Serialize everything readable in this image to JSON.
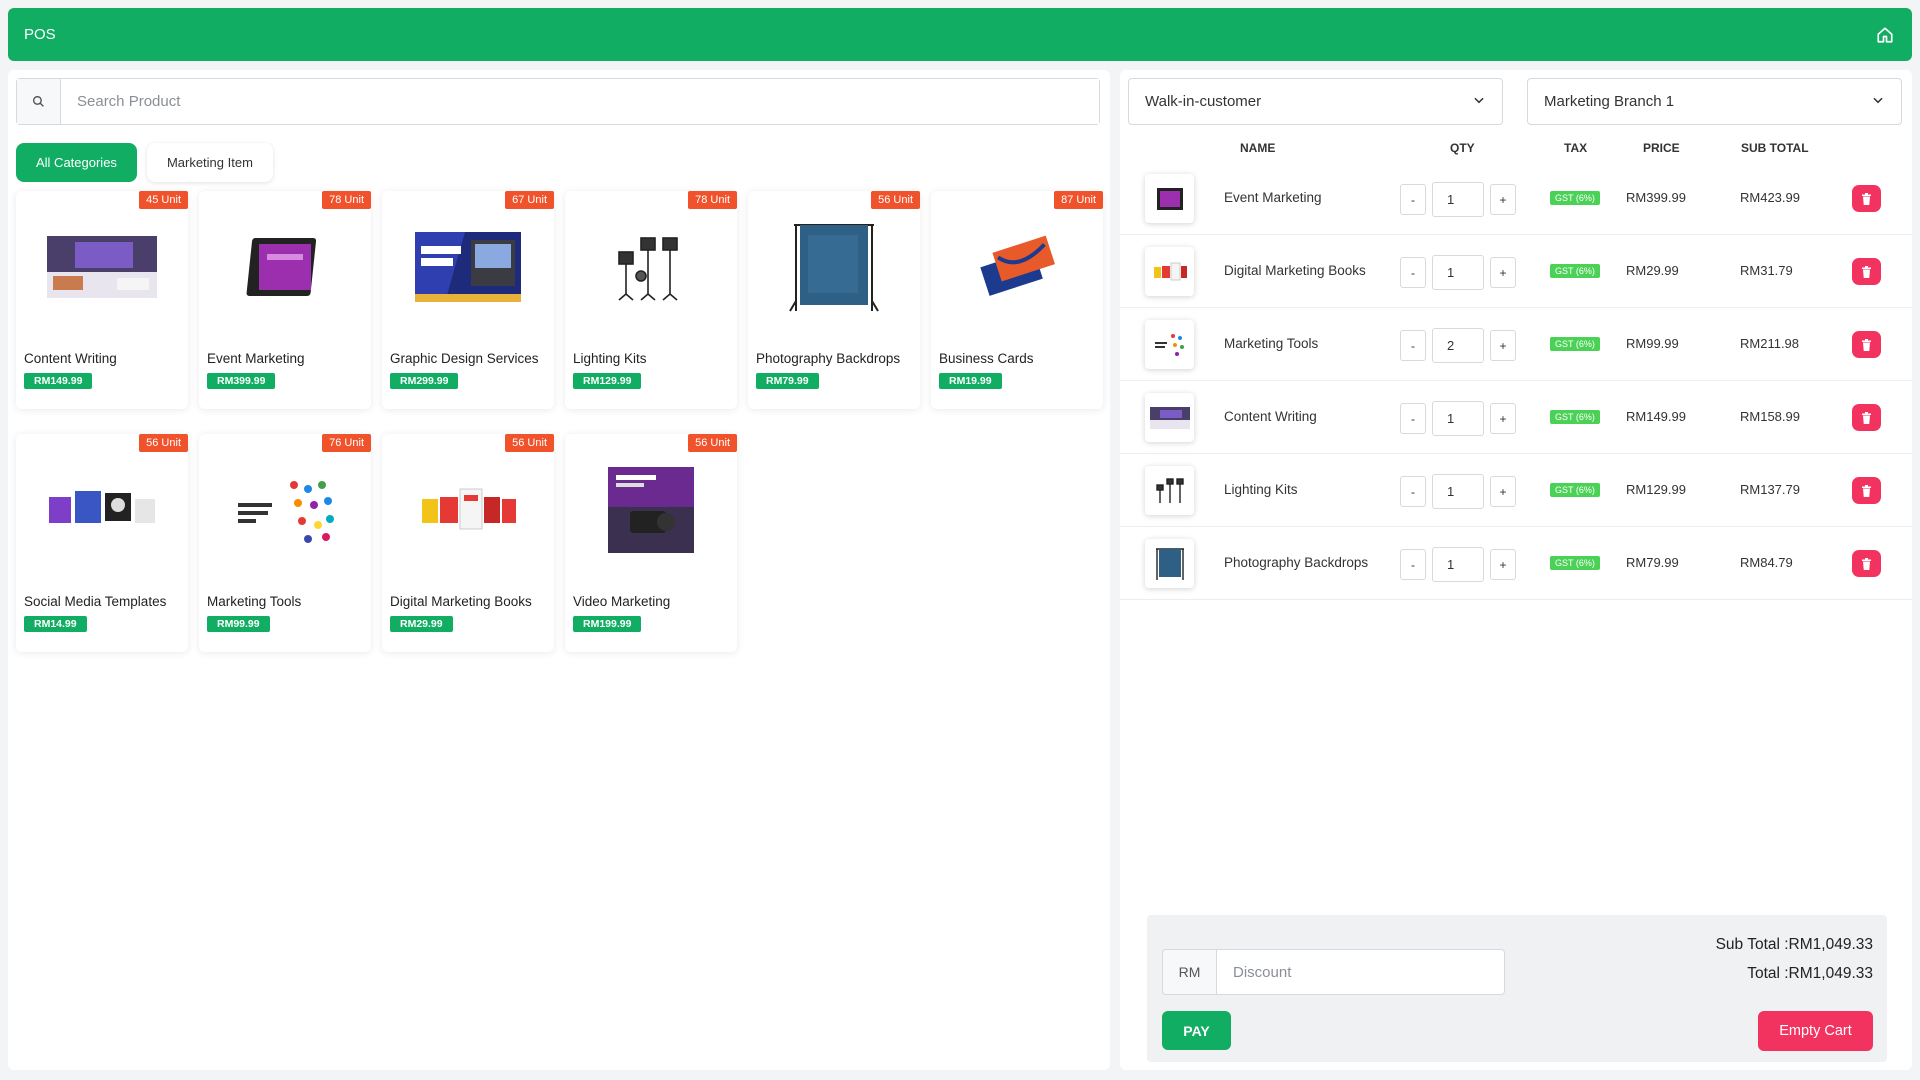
{
  "app": {
    "title": "POS",
    "home_icon": "home-icon"
  },
  "search": {
    "placeholder": "Search Product",
    "icon": "search-icon"
  },
  "categories": [
    {
      "label": "All Categories",
      "active": true
    },
    {
      "label": "Marketing Item",
      "active": false
    }
  ],
  "products": [
    {
      "name": "Content Writing",
      "price": "RM149.99",
      "stock": "45 Unit"
    },
    {
      "name": "Event Marketing",
      "price": "RM399.99",
      "stock": "78 Unit"
    },
    {
      "name": "Graphic Design Services",
      "price": "RM299.99",
      "stock": "67 Unit"
    },
    {
      "name": "Lighting Kits",
      "price": "RM129.99",
      "stock": "78 Unit"
    },
    {
      "name": "Photography Backdrops",
      "price": "RM79.99",
      "stock": "56 Unit"
    },
    {
      "name": "Business Cards",
      "price": "RM19.99",
      "stock": "87 Unit"
    },
    {
      "name": "Social Media Templates",
      "price": "RM14.99",
      "stock": "56 Unit"
    },
    {
      "name": "Marketing Tools",
      "price": "RM99.99",
      "stock": "76 Unit"
    },
    {
      "name": "Digital Marketing Books",
      "price": "RM29.99",
      "stock": "56 Unit"
    },
    {
      "name": "Video Marketing",
      "price": "RM199.99",
      "stock": "56 Unit"
    }
  ],
  "customer_select": {
    "value": "Walk-in-customer"
  },
  "branch_select": {
    "value": "Marketing Branch 1"
  },
  "cart": {
    "headers": {
      "name": "NAME",
      "qty": "QTY",
      "tax": "TAX",
      "price": "PRICE",
      "subtotal": "SUB TOTAL"
    },
    "minus": "-",
    "plus": "+",
    "items": [
      {
        "name": "Event Marketing",
        "qty": "1",
        "tax": "GST (6%)",
        "price": "RM399.99",
        "subtotal": "RM423.99"
      },
      {
        "name": "Digital Marketing Books",
        "qty": "1",
        "tax": "GST (6%)",
        "price": "RM29.99",
        "subtotal": "RM31.79"
      },
      {
        "name": "Marketing Tools",
        "qty": "2",
        "tax": "GST (6%)",
        "price": "RM99.99",
        "subtotal": "RM211.98"
      },
      {
        "name": "Content Writing",
        "qty": "1",
        "tax": "GST (6%)",
        "price": "RM149.99",
        "subtotal": "RM158.99"
      },
      {
        "name": "Lighting Kits",
        "qty": "1",
        "tax": "GST (6%)",
        "price": "RM129.99",
        "subtotal": "RM137.79"
      },
      {
        "name": "Photography Backdrops",
        "qty": "1",
        "tax": "GST (6%)",
        "price": "RM79.99",
        "subtotal": "RM84.79"
      }
    ]
  },
  "summary": {
    "currency_prefix": "RM",
    "discount_placeholder": "Discount",
    "subtotal_text": "Sub Total :RM1,049.33",
    "total_text": "Total :RM1,049.33",
    "pay_label": "PAY",
    "empty_label": "Empty Cart"
  },
  "colors": {
    "primary": "#10ad63",
    "stock_badge": "#f0522c",
    "danger": "#f2335f",
    "tax_badge": "#4cd157"
  }
}
